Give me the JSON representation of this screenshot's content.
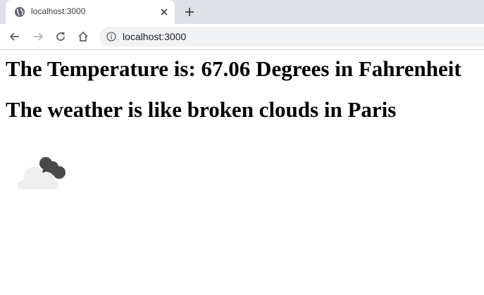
{
  "browser": {
    "tab": {
      "title": "localhost:3000"
    },
    "address_bar": {
      "url": "localhost:3000"
    }
  },
  "page": {
    "temperature_heading": "The Temperature is: 67.06 Degrees in Fahrenheit",
    "weather_heading": "The weather is like broken clouds in Paris",
    "weather_icon": "broken-clouds-icon"
  },
  "colors": {
    "tabstrip_bg": "#dee1e6",
    "omnibox_bg": "#f1f3f4",
    "cloud_dark": "#4a4a4a",
    "cloud_light": "#eeeeee"
  }
}
